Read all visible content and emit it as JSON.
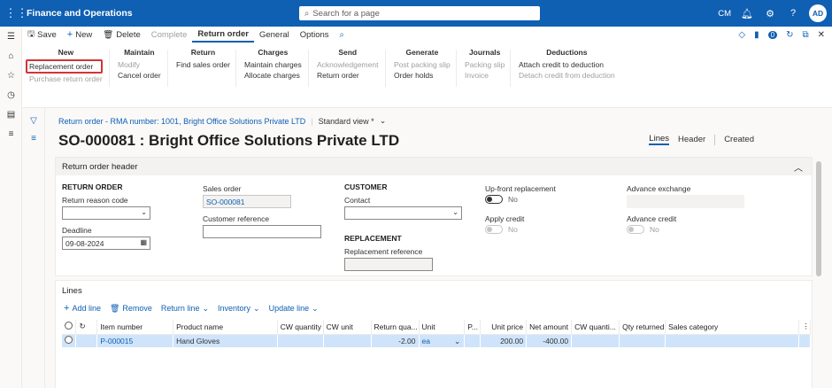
{
  "app": {
    "title": "Finance and Operations",
    "search_placeholder": "Search for a page",
    "company": "CM",
    "avatar": "AD"
  },
  "toolbar": {
    "save": "Save",
    "new": "New",
    "delete": "Delete",
    "complete": "Complete",
    "tabs": [
      "Return order",
      "General",
      "Options"
    ],
    "badge_count": "0"
  },
  "ribbon": {
    "new": {
      "title": "New",
      "items": [
        "Replacement order",
        "Purchase return order"
      ]
    },
    "maintain": {
      "title": "Maintain",
      "items": [
        "Modify",
        "Cancel order"
      ]
    },
    "return": {
      "title": "Return",
      "items": [
        "Find sales order"
      ]
    },
    "charges": {
      "title": "Charges",
      "items": [
        "Maintain charges",
        "Allocate charges"
      ]
    },
    "send": {
      "title": "Send",
      "items": [
        "Acknowledgement",
        "Return order"
      ]
    },
    "generate": {
      "title": "Generate",
      "items": [
        "Post packing slip",
        "Order holds"
      ]
    },
    "journals": {
      "title": "Journals",
      "items": [
        "Packing slip",
        "Invoice"
      ]
    },
    "deductions": {
      "title": "Deductions",
      "items": [
        "Attach credit to deduction",
        "Detach credit from deduction"
      ]
    }
  },
  "page": {
    "breadcrumb": "Return order - RMA number: 1001, Bright Office Solutions Private LTD",
    "view": "Standard view *",
    "title": "SO-000081 : Bright Office Solutions Private LTD",
    "view_tabs": [
      "Lines",
      "Header",
      "Created"
    ]
  },
  "header_card": {
    "title": "Return order header",
    "return_order_section": "RETURN ORDER",
    "return_reason_label": "Return reason code",
    "return_reason_value": "",
    "deadline_label": "Deadline",
    "deadline_value": "09-08-2024",
    "sales_order_label": "Sales order",
    "sales_order_value": "SO-000081",
    "customer_ref_label": "Customer reference",
    "customer_ref_value": "",
    "customer_section": "CUSTOMER",
    "contact_label": "Contact",
    "contact_value": "",
    "replacement_section": "REPLACEMENT",
    "replacement_ref_label": "Replacement reference",
    "replacement_ref_value": "",
    "upfront_label": "Up-front replacement",
    "upfront_value": "No",
    "apply_credit_label": "Apply credit",
    "apply_credit_value": "No",
    "adv_exchange_label": "Advance exchange",
    "adv_credit_label": "Advance credit",
    "adv_credit_value": "No"
  },
  "lines_card": {
    "title": "Lines",
    "actions": [
      "Add line",
      "Remove",
      "Return line",
      "Inventory",
      "Update line"
    ],
    "columns": [
      "Item number",
      "Product name",
      "CW quantity",
      "CW unit",
      "Return qua...",
      "Unit",
      "P...",
      "Unit price",
      "Net amount",
      "CW quanti...",
      "Qty returned",
      "Sales category"
    ],
    "rows": [
      {
        "item": "P-000015",
        "product": "Hand Gloves",
        "cw_qty": "",
        "cw_unit": "",
        "return_qty": "-2.00",
        "unit": "ea",
        "p": "",
        "unit_price": "200.00",
        "net_amount": "-400.00",
        "cw_quant": "",
        "qty_returned": "",
        "sales_category": ""
      }
    ]
  }
}
